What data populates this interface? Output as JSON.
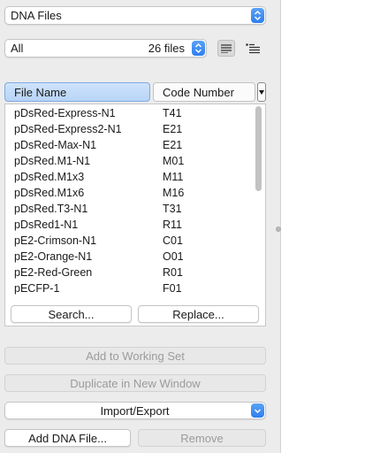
{
  "document_popup": {
    "label": "DNA Files"
  },
  "filter": {
    "selected": "All",
    "count_label": "26 files"
  },
  "view_buttons": {
    "list_icon": "text-align-left-icon",
    "detail_icon": "list-bullet-icon"
  },
  "table": {
    "columns": [
      "File Name",
      "Code Number"
    ],
    "rows": [
      {
        "name": "pDsRed-Express-N1",
        "code": "T41"
      },
      {
        "name": "pDsRed-Express2-N1",
        "code": "E21"
      },
      {
        "name": "pDsRed-Max-N1",
        "code": "E21"
      },
      {
        "name": "pDsRed.M1-N1",
        "code": "M01"
      },
      {
        "name": "pDsRed.M1x3",
        "code": "M11"
      },
      {
        "name": "pDsRed.M1x6",
        "code": "M16"
      },
      {
        "name": "pDsRed.T3-N1",
        "code": "T31"
      },
      {
        "name": "pDsRed1-N1",
        "code": "R11"
      },
      {
        "name": "pE2-Crimson-N1",
        "code": "C01"
      },
      {
        "name": "pE2-Orange-N1",
        "code": "O01"
      },
      {
        "name": "pE2-Red-Green",
        "code": "R01"
      },
      {
        "name": "pECFP-1",
        "code": "F01"
      }
    ]
  },
  "list_buttons": {
    "search": "Search...",
    "replace": "Replace..."
  },
  "actions": {
    "add_to_working_set": "Add to Working Set",
    "duplicate_in_new_window": "Duplicate in New Window",
    "import_export": "Import/Export",
    "add_dna_file": "Add DNA File...",
    "remove": "Remove"
  },
  "colors": {
    "accent": "#2f7ef0",
    "header_selected": "#b7d4f7"
  }
}
